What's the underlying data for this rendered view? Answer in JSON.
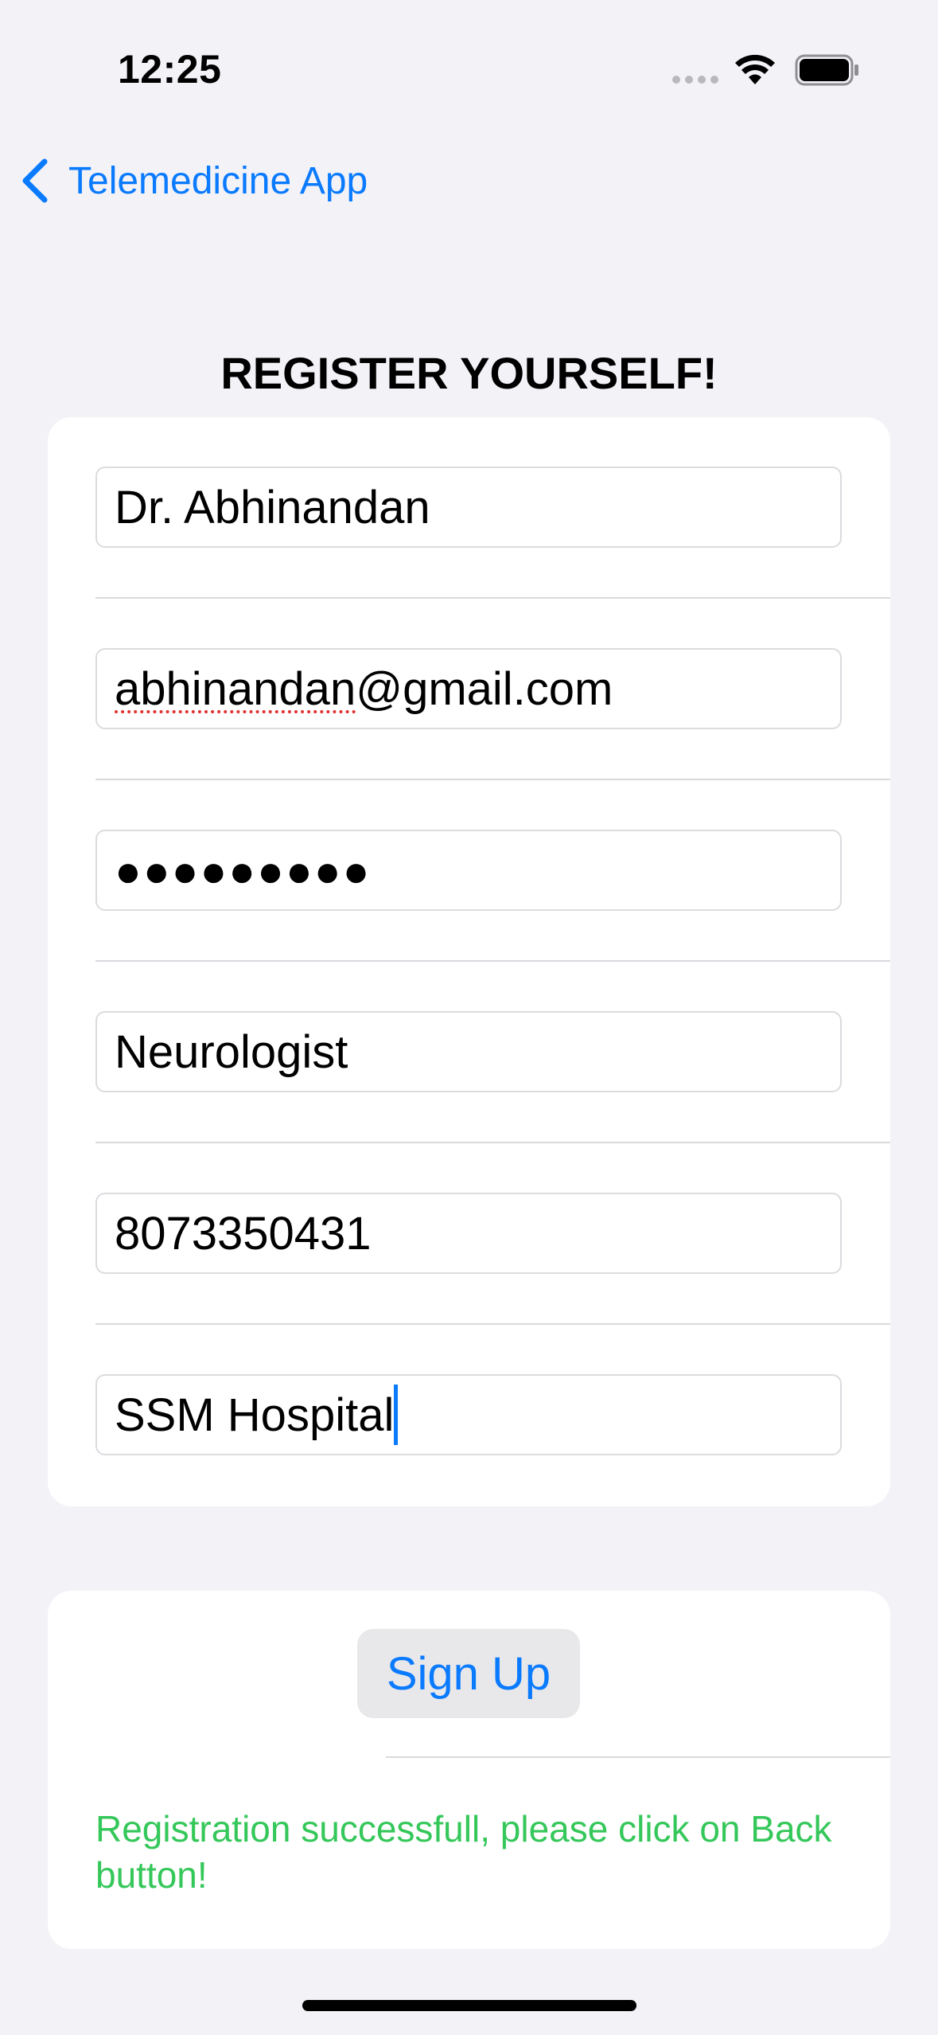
{
  "status_bar": {
    "time": "12:25"
  },
  "nav": {
    "back_label": "Telemedicine App"
  },
  "form": {
    "title": "REGISTER YOURSELF!",
    "fields": [
      {
        "name": "name",
        "value": "Dr. Abhinandan"
      },
      {
        "name": "email",
        "value_misspelled": "abhinandan",
        "value_rest": "@gmail.com"
      },
      {
        "name": "password",
        "value": "●●●●●●●●●"
      },
      {
        "name": "specialization",
        "value": "Neurologist"
      },
      {
        "name": "phone",
        "value": "8073350431"
      },
      {
        "name": "hospital",
        "value": "SSM Hospital"
      }
    ]
  },
  "actions": {
    "signup_label": "Sign Up",
    "message": "Registration successfull, please click on Back button!"
  },
  "colors": {
    "accent": "#0a7aff",
    "success": "#34c759",
    "background": "#f2f2f7"
  }
}
